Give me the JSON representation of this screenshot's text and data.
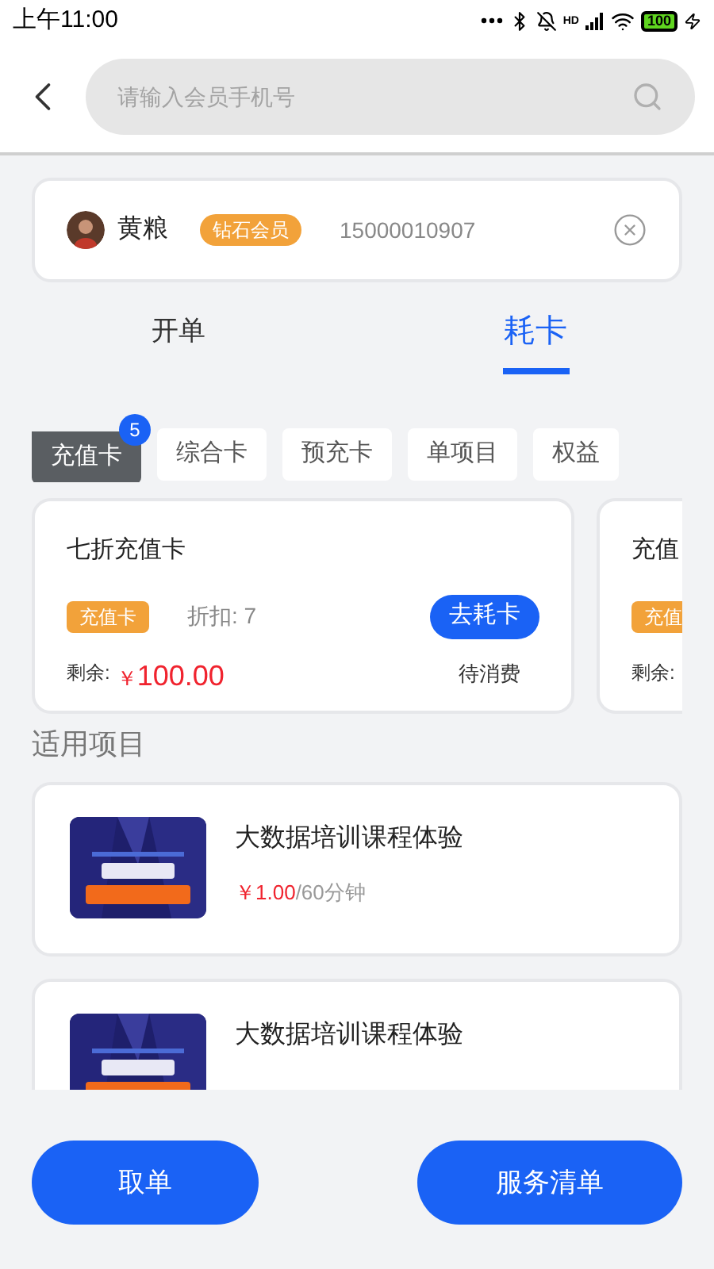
{
  "status_bar": {
    "time": "上午11:00",
    "network": "HD",
    "battery": "100"
  },
  "search": {
    "placeholder": "请输入会员手机号"
  },
  "member": {
    "name": "黄粮",
    "level": "钻石会员",
    "phone": "15000010907"
  },
  "tabs": [
    {
      "label": "开单",
      "selected": false
    },
    {
      "label": "耗卡",
      "selected": true
    }
  ],
  "categories": [
    {
      "label": "充值卡",
      "selected": true,
      "badge": "5"
    },
    {
      "label": "综合卡",
      "selected": false
    },
    {
      "label": "预充卡",
      "selected": false
    },
    {
      "label": "单项目",
      "selected": false
    },
    {
      "label": "权益",
      "selected": false
    }
  ],
  "cards": [
    {
      "title": "七折充值卡",
      "tag": "充值卡",
      "discount": "折扣: 7",
      "action": "去耗卡",
      "remaining_label": "剩余:",
      "currency": "￥",
      "amount": "100.00",
      "status": "待消费"
    },
    {
      "title": "充值",
      "tag": "充值",
      "remaining_label": "剩余:"
    }
  ],
  "section_title": "适用项目",
  "items": [
    {
      "kind": "picture",
      "name": "大数据培训课程体验",
      "price": "￥1.00",
      "unit": "/60分钟"
    },
    {
      "kind": "picture",
      "name": "大数据培训课程体验"
    }
  ],
  "buttons": [
    {
      "label": "取单"
    },
    {
      "label": "服务清单"
    }
  ]
}
